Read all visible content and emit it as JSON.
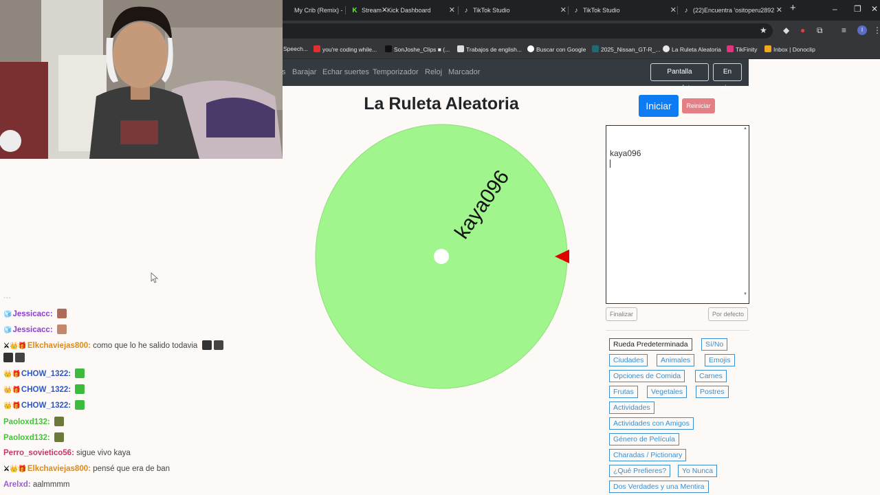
{
  "browser": {
    "tabs": [
      {
        "label": "My Crib (Remix) -",
        "icon": "music-tab-icon"
      },
      {
        "label": "Stream - Kick Dashboard",
        "icon": "kick-icon"
      },
      {
        "label": "TikTok Studio",
        "icon": "tiktok-icon"
      },
      {
        "label": "TikTok Studio",
        "icon": "tiktok-icon"
      },
      {
        "label": "(22)Encuentra 'ositoperu2892",
        "icon": "tiktok-icon"
      }
    ],
    "new_tab": "+",
    "window_buttons": [
      "–",
      "❐",
      "✕"
    ],
    "bookmarks": [
      {
        "label": "Speech...",
        "color": "#35363a"
      },
      {
        "label": "you're coding while...",
        "color": "#e03030"
      },
      {
        "label": "SonJoshe_Clips ■ (...",
        "color": "#111111"
      },
      {
        "label": "Trabajos de english...",
        "color": "#dddddd"
      },
      {
        "label": "Buscar con Google",
        "color": "#ffffff"
      },
      {
        "label": "2025_Nissan_GT-R_...",
        "color": "#1f6b72"
      },
      {
        "label": "La Ruleta Aleatoria",
        "color": "#e8e8e8"
      },
      {
        "label": "TikFinity",
        "color": "#e0357a"
      },
      {
        "label": "Inbox | Donoclip",
        "color": "#f2a71c"
      }
    ],
    "profile_initial": "I"
  },
  "site": {
    "nav_links": [
      "s",
      "Barajar",
      "Echar suertes",
      "Temporizador",
      "Reloj",
      "Marcador"
    ],
    "fullscreen_label": "Pantalla completa",
    "live_label": "En vivo",
    "title": "La Ruleta Aleatoria",
    "start_label": "Iniciar",
    "reset_label": "Reiniciar",
    "wheel": {
      "color": "#a0f58c",
      "segment_label": "kaya096",
      "pointer_color": "#e00000"
    },
    "names_text": "kaya096",
    "finish_label": "Finalizar",
    "default_label": "Por defecto",
    "presets": [
      "Rueda Predeterminada",
      "Sí/No",
      "Ciudades",
      "Animales",
      "Emojis",
      "Opciones de Comida",
      "Carnes",
      "Frutas",
      "Vegetales",
      "Postres",
      "Actividades",
      "Actividades con Amigos",
      "Género de Película",
      "Charadas / Pictionary",
      "¿Qué Prefieres?",
      "Yo Nunca",
      "Dos Verdades y una Mentira"
    ]
  },
  "chat": [
    {
      "user": "Jessicacc:",
      "color": "#8a3dd6",
      "badges": "🧊",
      "msg": "",
      "emotes": 1
    },
    {
      "user": "Jessicacc:",
      "color": "#8a3dd6",
      "badges": "🧊",
      "msg": "",
      "emotes": 1
    },
    {
      "user": "Elkchaviejas800:",
      "color": "#d88a1e",
      "badges": "⚔👑🎁",
      "msg": "como que lo he salido todavia",
      "emotes": 2
    },
    {
      "user": "CHOW_1322:",
      "color": "#2d56c9",
      "badges": "👑🎁",
      "msg": "",
      "emotes": 1
    },
    {
      "user": "CHOW_1322:",
      "color": "#2d56c9",
      "badges": "👑🎁",
      "msg": "",
      "emotes": 1
    },
    {
      "user": "CHOW_1322:",
      "color": "#2d56c9",
      "badges": "👑🎁",
      "msg": "",
      "emotes": 1
    },
    {
      "user": "Paoloxd132:",
      "color": "#43c23a",
      "badges": "",
      "msg": "",
      "emotes": 1
    },
    {
      "user": "Paoloxd132:",
      "color": "#43c23a",
      "badges": "",
      "msg": "",
      "emotes": 1
    },
    {
      "user": "Perro_sovietico56:",
      "color": "#c4396a",
      "badges": "",
      "msg": "sigue vivo kaya",
      "emotes": 0
    },
    {
      "user": "Elkchaviejas800:",
      "color": "#d88a1e",
      "badges": "⚔👑🎁",
      "msg": "pensé que era de ban",
      "emotes": 0
    },
    {
      "user": "Arelxd:",
      "color": "#9a5cd6",
      "badges": "",
      "msg": "aalmmmm",
      "emotes": 0
    }
  ]
}
